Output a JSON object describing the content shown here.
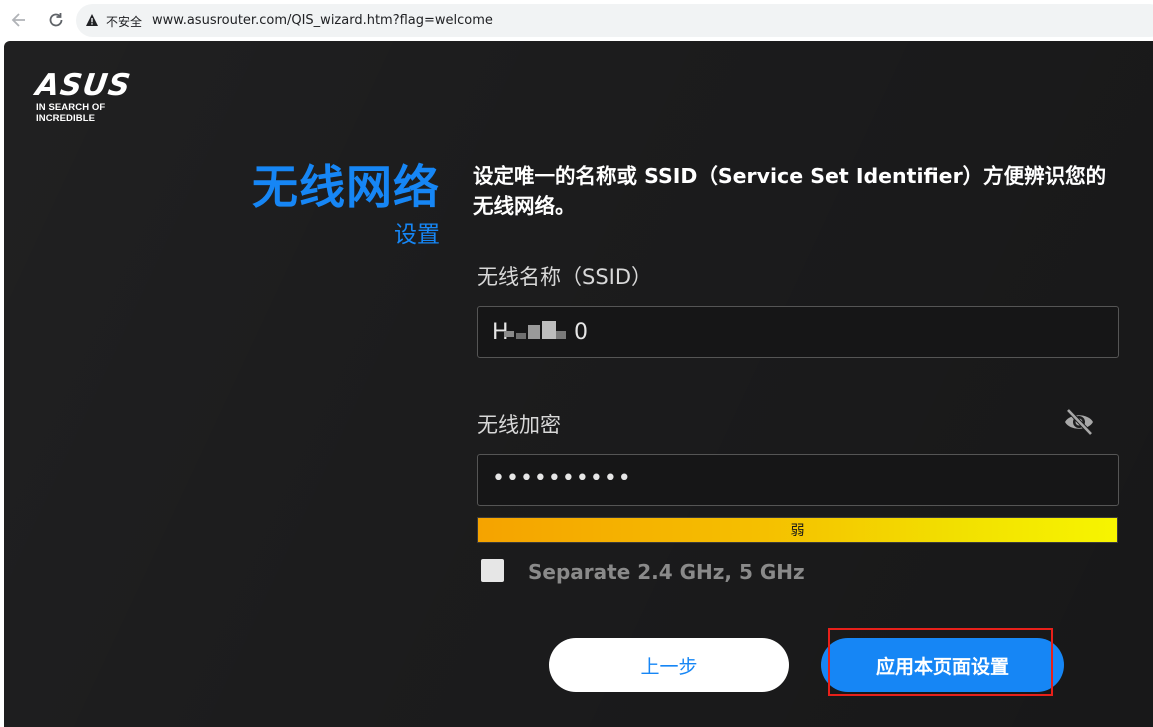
{
  "browser": {
    "security_label": "不安全",
    "url": "www.asusrouter.com/QIS_wizard.htm?flag=welcome"
  },
  "logo": {
    "brand": "ASUS",
    "tagline": "IN SEARCH OF INCREDIBLE"
  },
  "page": {
    "title": "无线网络",
    "subtitle": "设置",
    "description": "设定唯一的名称或 SSID（Service Set Identifier）方便辨识您的无线网络。"
  },
  "ssid_field": {
    "label": "无线名称（SSID）",
    "value_start": "H",
    "value_end": "0"
  },
  "key_field": {
    "label": "无线加密",
    "value": "••••••••••"
  },
  "strength": {
    "label": "弱"
  },
  "separate_checkbox": {
    "label": "Separate 2.4 GHz, 5 GHz",
    "checked": false
  },
  "buttons": {
    "prev": "上一步",
    "apply": "应用本页面设置"
  },
  "colors": {
    "accent": "#1686f5",
    "background": "#1c1c1d",
    "highlight": "#e8201a"
  }
}
